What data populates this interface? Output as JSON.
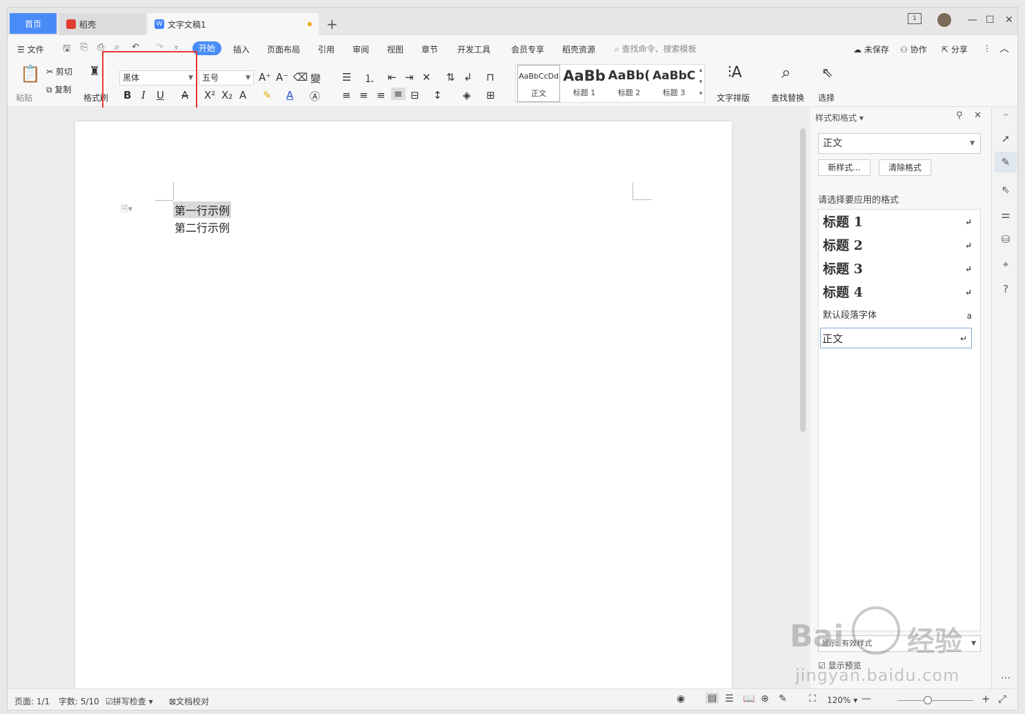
{
  "tabs": {
    "home": "首页",
    "daoke": "稻壳",
    "doc": "文字文稿1",
    "new": "+"
  },
  "menu": {
    "file": "文件",
    "items": [
      "开始",
      "插入",
      "页面布局",
      "引用",
      "审阅",
      "视图",
      "章节",
      "开发工具",
      "会员专享",
      "稻壳资源"
    ],
    "search_placeholder": "查找命令、搜索模板",
    "unsaved": "未保存",
    "collab": "协作",
    "share": "分享"
  },
  "ribbon": {
    "paste": "粘贴",
    "cut": "剪切",
    "copy": "复制",
    "format_painter": "格式刷",
    "font_name": "黑体",
    "font_size": "五号",
    "styles": [
      {
        "preview": "AaBbCcDd",
        "label": "正文"
      },
      {
        "preview": "AaBb",
        "label": "标题 1"
      },
      {
        "preview": "AaBb(",
        "label": "标题 2"
      },
      {
        "preview": "AaBbC",
        "label": "标题 3"
      }
    ],
    "text_layout": "文字排版",
    "find_replace": "查找替换",
    "select": "选择"
  },
  "document": {
    "line1": "第一行示例",
    "line2": "第二行示例"
  },
  "panel": {
    "title": "样式和格式",
    "current_style": "正文",
    "new_style": "新样式...",
    "clear_format": "清除格式",
    "subtitle": "请选择要应用的格式",
    "styles": [
      {
        "name": "标题  1"
      },
      {
        "name": "标题  2"
      },
      {
        "name": "标题  3"
      },
      {
        "name": "标题  4"
      },
      {
        "name": "默认段落字体"
      },
      {
        "name": "正文"
      }
    ],
    "show_label": "显示:",
    "show_value": "有效样式",
    "preview_label": "显示预览"
  },
  "status": {
    "page": "页面: 1/1",
    "words": "字数: 5/10",
    "spell": "拼写检查",
    "proof": "文档校对",
    "zoom": "120%"
  },
  "watermark": {
    "text1": "Bai",
    "text2": "经验",
    "url": "jingyan.baidu.com"
  }
}
